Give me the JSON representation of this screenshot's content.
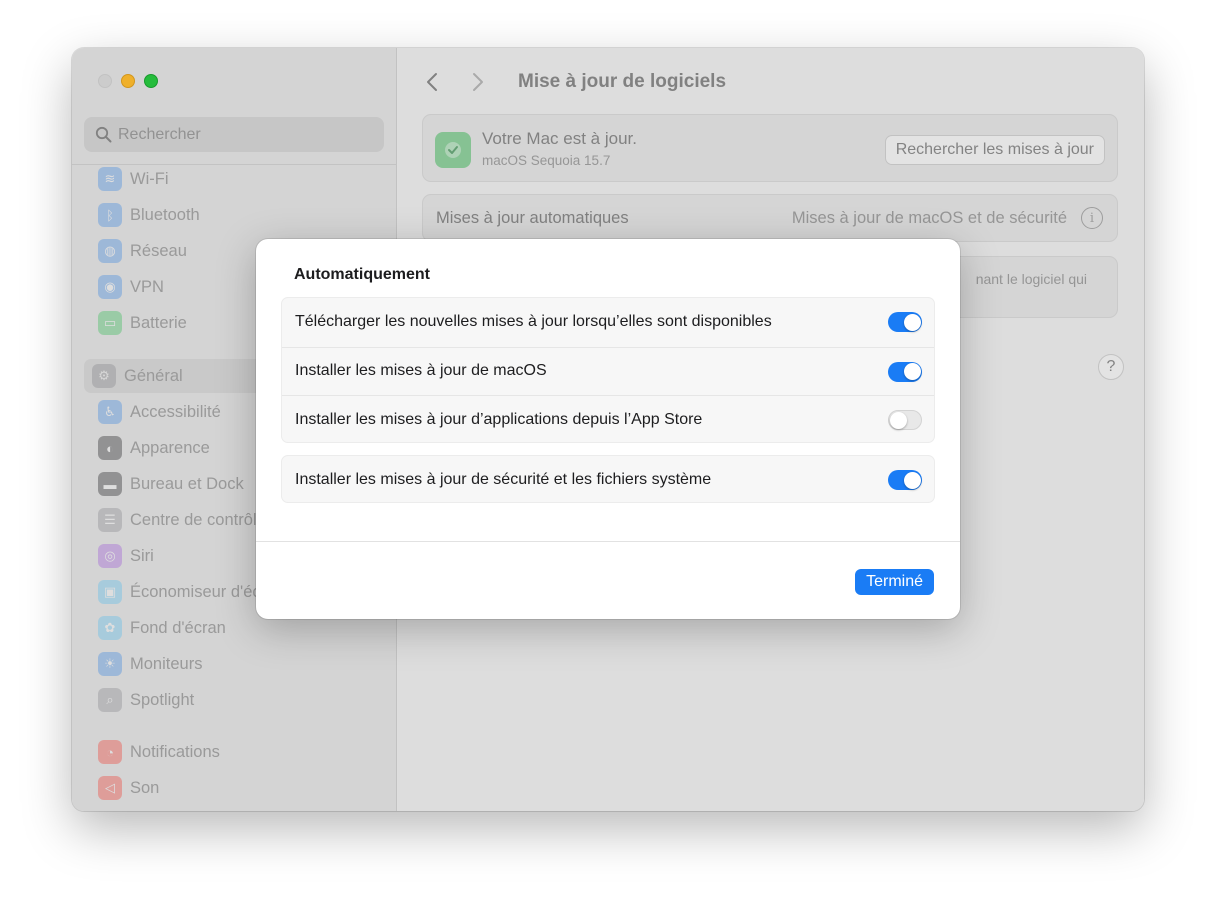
{
  "window": {
    "title": "Mise à jour de logiciels"
  },
  "sidebar": {
    "search_placeholder": "Rechercher",
    "items": [
      {
        "label": "Wi-Fi",
        "icon": "wifi-icon",
        "color": "#3b8ef0"
      },
      {
        "label": "Bluetooth",
        "icon": "bluetooth-icon",
        "color": "#3b8ef0"
      },
      {
        "label": "Réseau",
        "icon": "globe-icon",
        "color": "#3b8ef0"
      },
      {
        "label": "VPN",
        "icon": "vpn-icon",
        "color": "#3b8ef0"
      },
      {
        "label": "Batterie",
        "icon": "battery-icon",
        "color": "#34c759"
      },
      {
        "label": "Général",
        "icon": "gear-icon",
        "color": "#8e8e93"
      },
      {
        "label": "Accessibilité",
        "icon": "accessibility-icon",
        "color": "#3b8ef0"
      },
      {
        "label": "Apparence",
        "icon": "appearance-icon",
        "color": "#1d1d1f"
      },
      {
        "label": "Bureau et Dock",
        "icon": "dock-icon",
        "color": "#1d1d1f"
      },
      {
        "label": "Centre de contrôle",
        "icon": "control-center-icon",
        "color": "#8e8e93"
      },
      {
        "label": "Siri",
        "icon": "siri-icon",
        "color": "#a55ae5"
      },
      {
        "label": "Économiseur d'écran",
        "icon": "screensaver-icon",
        "color": "#5ac8fa"
      },
      {
        "label": "Fond d'écran",
        "icon": "wallpaper-icon",
        "color": "#5ac8fa"
      },
      {
        "label": "Moniteurs",
        "icon": "brightness-icon",
        "color": "#3b8ef0"
      },
      {
        "label": "Spotlight",
        "icon": "spotlight-icon",
        "color": "#8e8e93"
      },
      {
        "label": "Notifications",
        "icon": "bell-icon",
        "color": "#ff3b30"
      },
      {
        "label": "Son",
        "icon": "speaker-icon",
        "color": "#ff3b30"
      }
    ]
  },
  "main": {
    "status_title": "Votre Mac est à jour.",
    "status_subtitle": "macOS Sequoia 15.7",
    "check_button": "Rechercher les mises à jour",
    "auto_label": "Mises à jour automatiques",
    "auto_value": "Mises à jour de macOS et de sécurité",
    "note_text": "nant le logiciel qui",
    "help": "?"
  },
  "sheet": {
    "title": "Automatiquement",
    "rows": [
      {
        "label": "Télécharger les nouvelles mises à jour lorsqu’elles sont disponibles",
        "on": true
      },
      {
        "label": "Installer les mises à jour de macOS",
        "on": true
      },
      {
        "label": "Installer les mises à jour d’applications depuis l’App Store",
        "on": false
      },
      {
        "label": "Installer les mises à jour de sécurité et les fichiers système",
        "on": true
      }
    ],
    "done_button": "Terminé"
  }
}
